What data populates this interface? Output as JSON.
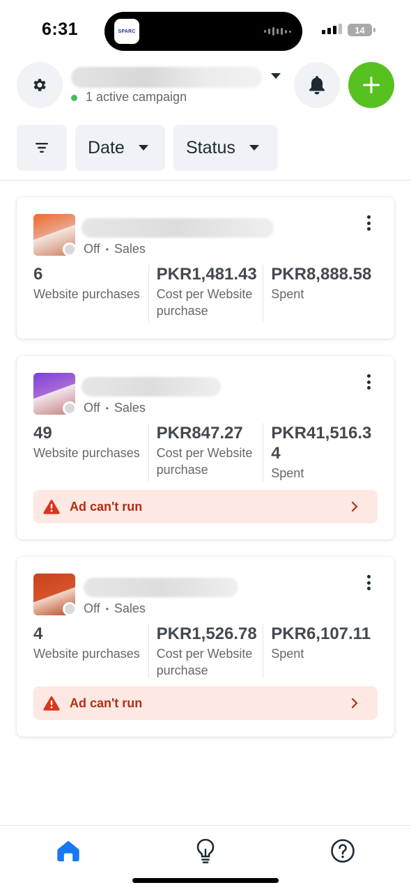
{
  "status_bar": {
    "time": "6:31",
    "island_app": "SPARC",
    "battery": "14"
  },
  "header": {
    "active_campaigns": "1 active campaign"
  },
  "filters": {
    "date_label": "Date",
    "status_label": "Status"
  },
  "campaigns": [
    {
      "status": "Off",
      "separator": "•",
      "objective": "Sales",
      "metrics": [
        {
          "value": "6",
          "label": "Website purchases"
        },
        {
          "value": "PKR1,481.43",
          "label": "Cost per Website purchase"
        },
        {
          "value": "PKR8,888.58",
          "label": "Spent"
        }
      ],
      "warning": null
    },
    {
      "status": "Off",
      "separator": "•",
      "objective": "Sales",
      "metrics": [
        {
          "value": "49",
          "label": "Website purchases"
        },
        {
          "value": "PKR847.27",
          "label": "Cost per Website purchase"
        },
        {
          "value": "PKR41,516.34",
          "label": "Spent"
        }
      ],
      "warning": "Ad can't run"
    },
    {
      "status": "Off",
      "separator": "•",
      "objective": "Sales",
      "metrics": [
        {
          "value": "4",
          "label": "Website purchases"
        },
        {
          "value": "PKR1,526.78",
          "label": "Cost per Website purchase"
        },
        {
          "value": "PKR6,107.11",
          "label": "Spent"
        }
      ],
      "warning": "Ad can't run"
    }
  ],
  "colors": {
    "create_button": "#56c11f",
    "active_dot": "#45bd62",
    "warning_bg": "#fde8e4",
    "warning_text": "#b32d12",
    "home_active": "#1877f2"
  },
  "bottom_nav": {
    "items": [
      "home-icon",
      "lightbulb-icon",
      "help-icon"
    ],
    "active": "home-icon"
  }
}
